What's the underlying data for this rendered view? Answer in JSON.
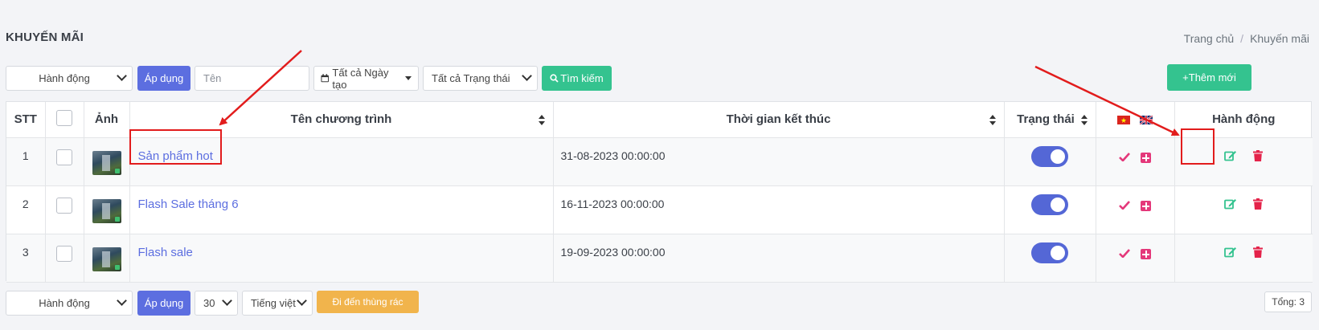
{
  "page": {
    "title": "KHUYẾN MÃI",
    "breadcrumb": [
      "Trang chủ",
      "Khuyến mãi"
    ]
  },
  "toolbar": {
    "bulk_action": "Hành động",
    "apply_label": "Áp dụng",
    "name_placeholder": "Tên",
    "date_filter": "Tất cả Ngày tạo",
    "status_filter": "Tất cả Trạng thái",
    "search_label": "Tìm kiếm",
    "add_new_label": "+Thêm mới"
  },
  "table": {
    "headers": {
      "stt": "STT",
      "image": "Ảnh",
      "name": "Tên chương trình",
      "end_time": "Thời gian kết thúc",
      "status": "Trạng thái",
      "actions": "Hành động"
    },
    "rows": [
      {
        "stt": "1",
        "name": "Sản phẩm hot",
        "end_time": "31-08-2023 00:00:00",
        "status_on": true
      },
      {
        "stt": "2",
        "name": "Flash Sale tháng 6",
        "end_time": "16-11-2023 00:00:00",
        "status_on": true
      },
      {
        "stt": "3",
        "name": "Flash sale",
        "end_time": "19-09-2023 00:00:00",
        "status_on": true
      }
    ]
  },
  "footer": {
    "bulk_action": "Hành động",
    "apply_label": "Áp dụng",
    "page_size": "30",
    "language": "Tiếng việt",
    "trash_label": "Đi đến thùng rác",
    "total_label": "Tổng: 3"
  },
  "colors": {
    "primary": "#5c6ee0",
    "success": "#34c38f",
    "warning": "#f1b44c",
    "danger": "#e4387a",
    "annotation": "#e21c1c"
  }
}
